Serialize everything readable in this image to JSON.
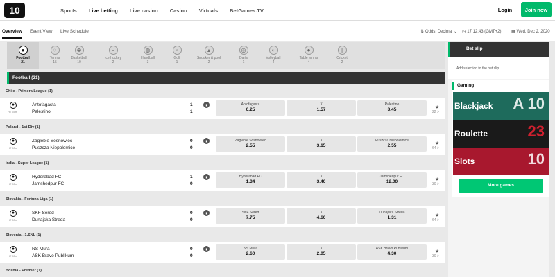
{
  "brand": {
    "logo_text": "10",
    "accent": "#00b96b"
  },
  "topnav": {
    "items": [
      "Sports",
      "Live betting",
      "Live casino",
      "Casino",
      "Virtuals",
      "BetGames.TV"
    ],
    "active_index": 1,
    "login": "Login",
    "join": "Join now"
  },
  "subnav": {
    "tabs": [
      "Overview",
      "Event View",
      "Live Schedule"
    ],
    "active_index": 0,
    "odds": "Odds: Decimal",
    "time": "17:12:43 (GMT+2)",
    "date": "Wed, Dec 2, 2020"
  },
  "sports": [
    {
      "name": "Football",
      "count": "21",
      "icon": "football-icon",
      "active": true
    },
    {
      "name": "Tennis",
      "count": "15",
      "icon": "tennis-icon"
    },
    {
      "name": "Basketball",
      "count": "10",
      "icon": "basketball-icon"
    },
    {
      "name": "Ice hockey",
      "count": "2",
      "icon": "ice-hockey-icon"
    },
    {
      "name": "Handball",
      "count": "3",
      "icon": "handball-icon"
    },
    {
      "name": "Golf",
      "count": "1",
      "icon": "golf-icon"
    },
    {
      "name": "Snooker & pool",
      "count": "2",
      "icon": "snooker-icon"
    },
    {
      "name": "Darts",
      "count": "1",
      "icon": "darts-icon"
    },
    {
      "name": "Volleyball",
      "count": "4",
      "icon": "volleyball-icon"
    },
    {
      "name": "Table tennis",
      "count": "4",
      "icon": "table-tennis-icon"
    },
    {
      "name": "Cricket",
      "count": "2",
      "icon": "cricket-icon"
    }
  ],
  "section": {
    "title": "Football (21)"
  },
  "leagues": [
    {
      "name": "Chile - Primera League (1)",
      "match": {
        "time": "HT 55m",
        "home": "Antofagasta",
        "away": "Palestino",
        "home_score": "1",
        "away_score": "1",
        "odds": [
          {
            "label": "Antofagasta",
            "value": "6.25"
          },
          {
            "label": "X",
            "value": "1.57"
          },
          {
            "label": "Palestino",
            "value": "3.45"
          }
        ],
        "more": "22 >"
      }
    },
    {
      "name": "Poland - 1st Div (1)",
      "match": {
        "time": "HT 53m",
        "home": "Zaglebie Sosnowiec",
        "away": "Puszcza Niepolomice",
        "home_score": "0",
        "away_score": "0",
        "odds": [
          {
            "label": "Zaglebie Sosnowiec",
            "value": "2.55"
          },
          {
            "label": "X",
            "value": "3.15"
          },
          {
            "label": "Puszcza Niepolomice",
            "value": "2.55"
          }
        ],
        "more": "64 >"
      }
    },
    {
      "name": "India - Super League (1)",
      "match": {
        "time": "HT 55m",
        "home": "Hyderabad FC",
        "away": "Jamshedpur FC",
        "home_score": "1",
        "away_score": "0",
        "odds": [
          {
            "label": "Hyderabad FC",
            "value": "1.34"
          },
          {
            "label": "X",
            "value": "3.40"
          },
          {
            "label": "Jamshedpur FC",
            "value": "12.00"
          }
        ],
        "more": "30 >"
      }
    },
    {
      "name": "Slovakia - Fortuna Liga (1)",
      "match": {
        "time": "HT 53m",
        "home": "SKF Sered",
        "away": "Dunajska Streda",
        "home_score": "0",
        "away_score": "0",
        "odds": [
          {
            "label": "SKF Sered",
            "value": "7.75"
          },
          {
            "label": "X",
            "value": "4.60"
          },
          {
            "label": "Dunajska Streda",
            "value": "1.31"
          }
        ],
        "more": "64 >"
      }
    },
    {
      "name": "Slovenia - 1.SNL (1)",
      "match": {
        "time": "HT 55m",
        "home": "NS Mura",
        "away": "ASK Bravo Publikum",
        "home_score": "0",
        "away_score": "0",
        "odds": [
          {
            "label": "NS Mura",
            "value": "2.60"
          },
          {
            "label": "X",
            "value": "2.05"
          },
          {
            "label": "ASK Bravo Publikum",
            "value": "4.30"
          }
        ],
        "more": "30 >"
      }
    },
    {
      "name": "Bosnia - Premier (1)"
    }
  ],
  "betslip": {
    "title": "Bet slip",
    "empty_text": "Add selection to the bet slip"
  },
  "gaming": {
    "title": "Gaming",
    "games": [
      {
        "name": "Blackjack",
        "color": "#1e6b5c",
        "deco": "A 10"
      },
      {
        "name": "Roulette",
        "color": "#1a1a1a",
        "deco": "23"
      },
      {
        "name": "Slots",
        "color": "#a8182e",
        "deco": "10"
      }
    ],
    "more_button": "More games"
  }
}
